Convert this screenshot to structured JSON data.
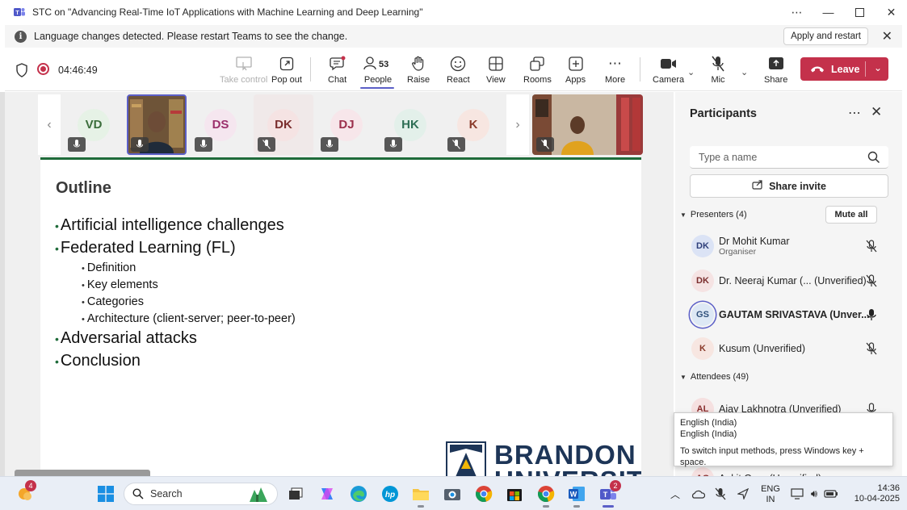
{
  "window": {
    "title": "STC on \"Advancing Real-Time IoT Applications with Machine Learning and Deep Learning\""
  },
  "notification": {
    "message": "Language changes detected. Please restart Teams to see the change.",
    "apply_label": "Apply and restart"
  },
  "toolbar": {
    "timer": "04:46:49",
    "take_control": "Take control",
    "pop_out": "Pop out",
    "chat": "Chat",
    "people": "People",
    "people_count": "53",
    "raise": "Raise",
    "react": "React",
    "view": "View",
    "rooms": "Rooms",
    "apps": "Apps",
    "more": "More",
    "camera": "Camera",
    "mic": "Mic",
    "share": "Share",
    "leave": "Leave",
    "accent": "#5b5fc7",
    "leave_color": "#c4314b"
  },
  "gallery": {
    "tiles": [
      {
        "initials": "VD",
        "bg": "#e6f2e6",
        "color": "#3b6e3b"
      },
      {
        "initials": "DS",
        "bg": "#f5e6ef",
        "color": "#9b2f6b"
      },
      {
        "initials": "DK",
        "bg": "#f5e3e3",
        "color": "#7a2e2e"
      },
      {
        "initials": "DJ",
        "bg": "#f7e6ea",
        "color": "#9b2f4b"
      },
      {
        "initials": "HK",
        "bg": "#e3f0ea",
        "color": "#2e6e55"
      },
      {
        "initials": "K",
        "bg": "#f7e6e1",
        "color": "#8a3a2a"
      }
    ]
  },
  "slide": {
    "heading": "Outline",
    "bullets": [
      "Artificial intelligence challenges",
      "Federated Learning (FL)",
      "Adversarial attacks",
      "Conclusion"
    ],
    "sub_bullets": [
      "Definition",
      "Key elements",
      "Categories",
      "Architecture (client-server; peer-to-peer)"
    ],
    "brand_line1": "BRANDON",
    "brand_line2": "UNIVERSITY"
  },
  "participants": {
    "title": "Participants",
    "search_placeholder": "Type a name",
    "share_invite": "Share invite",
    "presenters_label": "Presenters (4)",
    "mute_all": "Mute all",
    "presenters": [
      {
        "initials": "DK",
        "name": "Dr Mohit Kumar",
        "role": "Organiser",
        "bg": "#dbe3f5",
        "color": "#2e3f7a"
      },
      {
        "initials": "DK",
        "name": "Dr. Neeraj Kumar (... (Unverified)",
        "role": "",
        "bg": "#f5e3e3",
        "color": "#7a2e2e"
      },
      {
        "initials": "GS",
        "name": "GAUTAM SRIVASTAVA (Unver...",
        "role": "",
        "bg": "#dde8f5",
        "color": "#2e4f7a"
      },
      {
        "initials": "K",
        "name": "Kusum (Unverified)",
        "role": "",
        "bg": "#f7e6e1",
        "color": "#8a3a2a"
      }
    ],
    "attendees_label": "Attendees (49)",
    "attendees": [
      {
        "initials": "AL",
        "name": "Ajay Lakhnotra (Unverified)",
        "bg": "#f5e0e0",
        "color": "#8a2e2e"
      },
      {
        "initials": "AG",
        "name": "Ankit Garg (Unverified)",
        "bg": "#f5e0e0",
        "color": "#8a2e2e"
      }
    ]
  },
  "tooltip": {
    "line1": "English (India)",
    "line2": "English (India)",
    "line3": "To switch input methods, press Windows key + space."
  },
  "taskbar": {
    "weather_badge": "4",
    "search_label": "Search",
    "teams_badge": "2",
    "lang_line1": "ENG",
    "lang_line2": "IN",
    "time": "14:36",
    "date": "10-04-2025"
  }
}
